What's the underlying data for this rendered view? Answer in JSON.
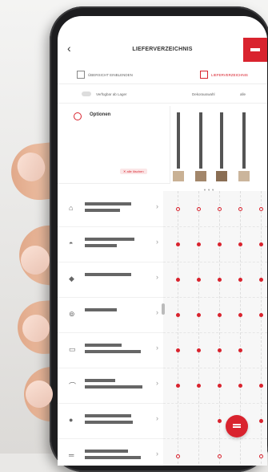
{
  "header": {
    "title": "LIEFERVERZEICHNIS",
    "back_icon": "chevron-left-icon",
    "menu_icon": "filter-lines-icon",
    "accent": "#d9232e"
  },
  "toolbar": {
    "left_label": "ÜBERSICHT EINBLENDEN",
    "right_label": "LIEFERVERZEICHNIS"
  },
  "filter_row": {
    "availability_label": "Verfügbar ab Lager",
    "right_label": "Dekorauswahl",
    "right_value": "alle"
  },
  "options": {
    "label": "Optionen",
    "reset_label": "✕ alle löschen"
  },
  "swatches": [
    "#c9b194",
    "#a2866a",
    "#8a6e54",
    "#cbb59c"
  ],
  "grid_hint": "▼ ▼ ▼",
  "list_items": [
    {
      "icon": "cabinet-icon",
      "w1": 58,
      "w2": 44
    },
    {
      "icon": "tray-icon",
      "w1": 62,
      "w2": 40
    },
    {
      "icon": "diamond-icon",
      "w1": 58,
      "w2": 0
    },
    {
      "icon": "spiral-icon",
      "w1": 40,
      "w2": 0
    },
    {
      "icon": "shelf-icon",
      "w1": 46,
      "w2": 70
    },
    {
      "icon": "hook-icon",
      "w1": 38,
      "w2": 72
    },
    {
      "icon": "disc-icon",
      "w1": 58,
      "w2": 60
    },
    {
      "icon": "rail-icon",
      "w1": 54,
      "w2": 70
    }
  ],
  "availability_matrix": [
    [
      "ring",
      "ring",
      "ring",
      "ring",
      "ring"
    ],
    [
      "dot",
      "dot",
      "dot",
      "dot",
      "dot"
    ],
    [
      "dot",
      "dot",
      "dot",
      "dot",
      "dot"
    ],
    [
      "dot",
      "dot",
      "dot",
      "dot",
      "dot"
    ],
    [
      "dot",
      "dot",
      "dot",
      "dot",
      ""
    ],
    [
      "dot",
      "dot",
      "dot",
      "dot",
      "dot"
    ],
    [
      "",
      "",
      "dot",
      "",
      "dot"
    ],
    [
      "ring",
      "",
      "ring",
      "",
      "ring"
    ]
  ],
  "fab_icon": "filter-lines-icon"
}
